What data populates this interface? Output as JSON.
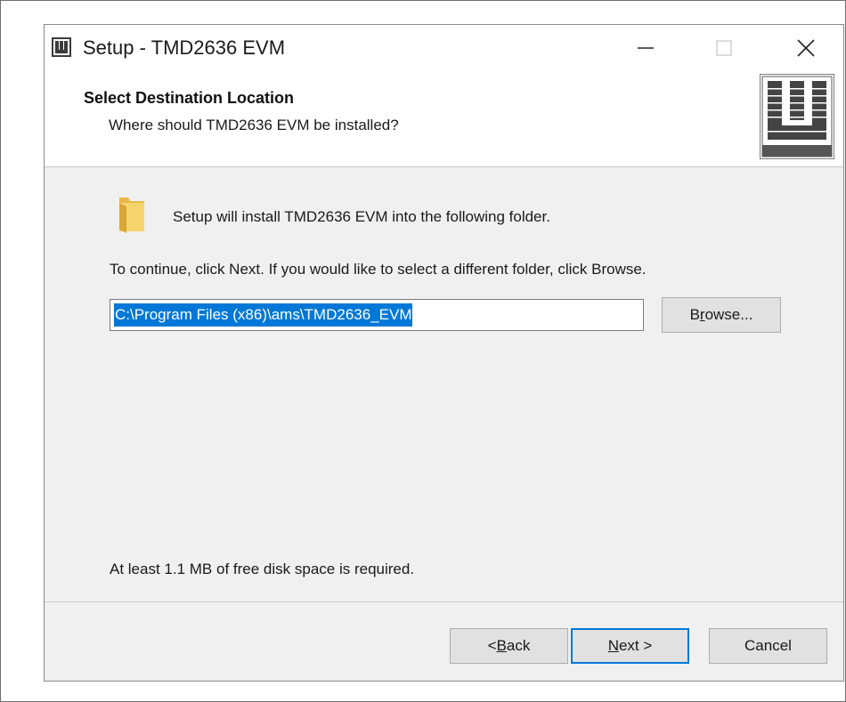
{
  "window": {
    "title": "Setup - TMD2636 EVM",
    "icon": "app-logo-icon"
  },
  "titlebar": {
    "minimize_icon": "minimize-icon",
    "maximize_icon": "maximize-icon",
    "close_icon": "close-icon"
  },
  "header": {
    "title": "Select Destination Location",
    "subtitle": "Where should TMD2636 EVM be installed?",
    "logo": "ams-logo-icon"
  },
  "body": {
    "folder_icon": "folder-icon",
    "install_text": "Setup will install TMD2636 EVM into the following folder.",
    "continue_text": "To continue, click Next. If you would like to select a different folder, click Browse.",
    "path_value": "C:\\Program Files (x86)\\ams\\TMD2636_EVM",
    "disk_space_text": "At least 1.1 MB of free disk space is required."
  },
  "buttons": {
    "browse_pre": "B",
    "browse_accel": "r",
    "browse_post": "owse...",
    "back_pre": "< ",
    "back_accel": "B",
    "back_post": "ack",
    "next_pre": "",
    "next_accel": "N",
    "next_post": "ext >",
    "cancel": "Cancel"
  },
  "colors": {
    "selection": "#0078d7",
    "window_bg": "#f0f0f0",
    "button_bg": "#e1e1e1",
    "default_button_border": "#0078d7"
  }
}
